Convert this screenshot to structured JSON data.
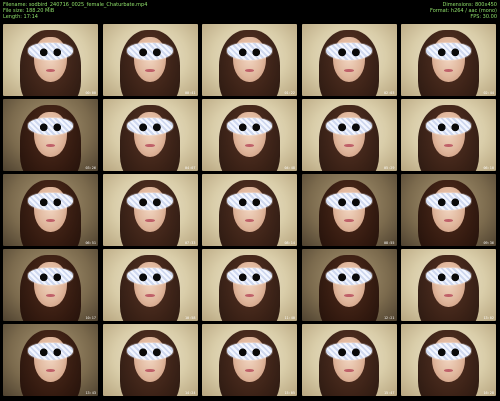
{
  "header": {
    "left": [
      "Filename: sodbird_240716_0025_female_Chaturbate.mp4",
      "File size: 188.20 MiB",
      "Length: 17:14"
    ],
    "right": [
      "Dimensions: 800x450",
      "Format: h264 / aac (mono)",
      "FPS: 30.00"
    ]
  },
  "thumbnails": [
    {
      "timestamp": "00:00",
      "tone": "bright"
    },
    {
      "timestamp": "00:41",
      "tone": "bright"
    },
    {
      "timestamp": "01:22",
      "tone": "bright"
    },
    {
      "timestamp": "02:03",
      "tone": "bright"
    },
    {
      "timestamp": "02:44",
      "tone": "bright"
    },
    {
      "timestamp": "03:26",
      "tone": "dim"
    },
    {
      "timestamp": "04:07",
      "tone": "bright"
    },
    {
      "timestamp": "04:48",
      "tone": "bright"
    },
    {
      "timestamp": "05:29",
      "tone": "bright"
    },
    {
      "timestamp": "06:10",
      "tone": "bright"
    },
    {
      "timestamp": "06:51",
      "tone": "dim"
    },
    {
      "timestamp": "07:33",
      "tone": "bright"
    },
    {
      "timestamp": "08:14",
      "tone": "bright"
    },
    {
      "timestamp": "08:55",
      "tone": "dim"
    },
    {
      "timestamp": "09:36",
      "tone": "dim"
    },
    {
      "timestamp": "10:17",
      "tone": "dim"
    },
    {
      "timestamp": "10:58",
      "tone": "bright"
    },
    {
      "timestamp": "11:40",
      "tone": "bright"
    },
    {
      "timestamp": "12:21",
      "tone": "dim"
    },
    {
      "timestamp": "13:02",
      "tone": "bright"
    },
    {
      "timestamp": "13:43",
      "tone": "dim"
    },
    {
      "timestamp": "14:24",
      "tone": "bright"
    },
    {
      "timestamp": "15:05",
      "tone": "bright"
    },
    {
      "timestamp": "15:47",
      "tone": "bright"
    },
    {
      "timestamp": "16:28",
      "tone": "bright"
    }
  ],
  "colors": {
    "header_text": "#8fe06a",
    "background": "#000000"
  }
}
